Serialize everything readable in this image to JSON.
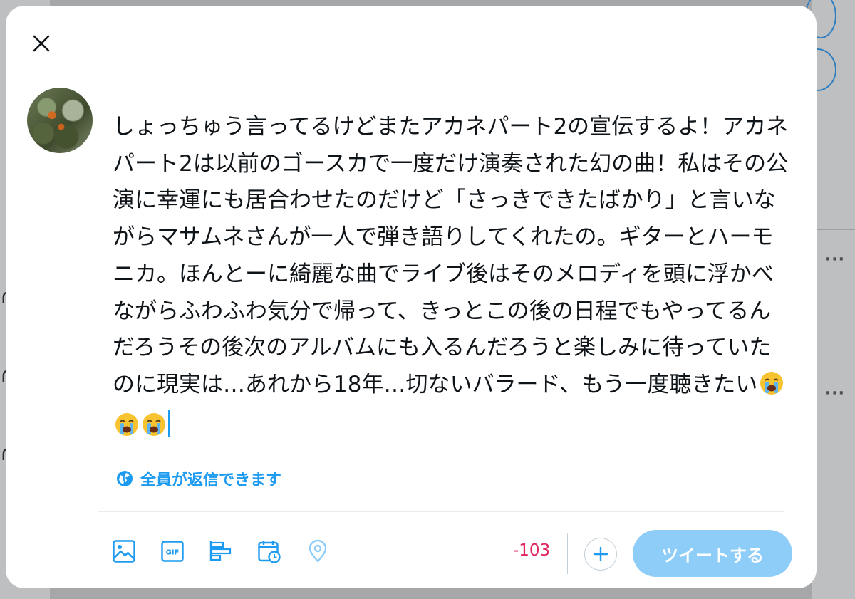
{
  "tweet_text": "しょっちゅう言ってるけどまたアカネパート2の宣伝するよ！アカネパート2は以前のゴースカで一度だけ演奏された幻の曲！私はその公演に幸運にも居合わせたのだけど「さっきできたばかり」と言いながらマサムネさんが一人で弾き語りしてくれたの。ギターとハーモニカ。ほんとーに綺麗な曲でライブ後はそのメロディを頭に浮かべながらふわふわ気分で帰って、きっとこの後の日程でもやってるんだろうその後次のアルバムにも入るんだろうと楽しみに待っていたのに現実は…あれから18年…切ないバラード、もう一度聴きたい",
  "tweet_emojis": [
    "loudly-crying-face",
    "loudly-crying-face",
    "loudly-crying-face"
  ],
  "reply_setting_label": "全員が返信できます",
  "char_counter": "-103",
  "tweet_button_label": "ツイートする",
  "icons": {
    "close": "close-icon",
    "globe": "globe-icon",
    "media": "image-icon",
    "gif": "gif-icon",
    "poll": "poll-icon",
    "schedule": "schedule-icon",
    "location": "location-icon",
    "add": "plus-icon"
  },
  "colors": {
    "accent": "#1d9bf0",
    "tweet_button_disabled": "#8ecdf8",
    "over_limit": "#e0245e",
    "text": "#0f1419"
  }
}
